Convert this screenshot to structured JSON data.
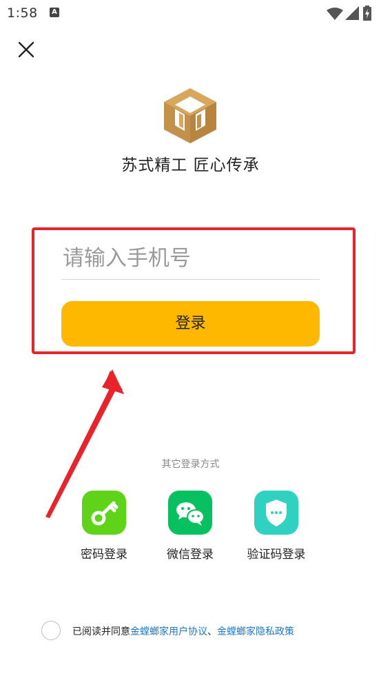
{
  "status_bar": {
    "time": "1:58",
    "notification_icon": "A"
  },
  "header": {
    "close_icon": "close-icon"
  },
  "brand": {
    "slogan": "苏式精工 匠心传承",
    "logo_color": "#cc9a4e"
  },
  "form": {
    "phone_placeholder": "请输入手机号",
    "phone_value": "",
    "login_label": "登录",
    "accent_color": "#ffb800",
    "highlight_color": "#e8232a"
  },
  "other_logins": {
    "label": "其它登录方式",
    "methods": [
      {
        "label": "密码登录",
        "icon": "key-icon",
        "color": "#5ed317"
      },
      {
        "label": "微信登录",
        "icon": "wechat-icon",
        "color": "#07c160"
      },
      {
        "label": "验证码登录",
        "icon": "shield-message-icon",
        "color": "#2fd1c0"
      }
    ]
  },
  "agreement": {
    "prefix": "已阅读并同意",
    "user_agreement": "金螳螂家用户协议",
    "separator": "、",
    "privacy_policy": "金螳螂家隐私政策",
    "link_color": "#1e78c8"
  }
}
